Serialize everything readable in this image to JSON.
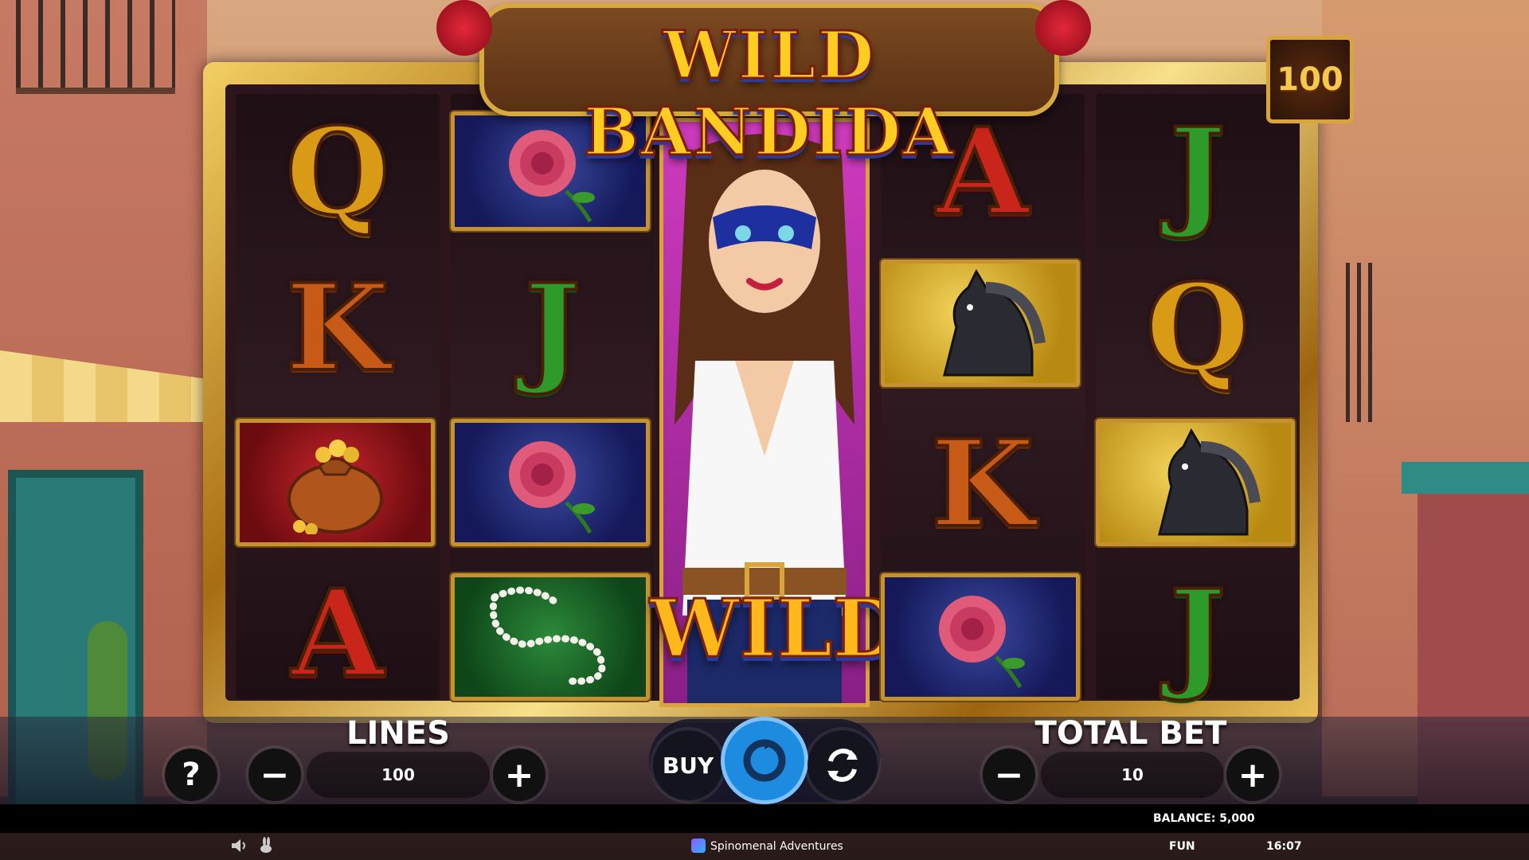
{
  "game": {
    "title": "WILD BANDIDA",
    "lines_badge": "100",
    "wild_label": "WILD"
  },
  "reels": [
    [
      "Q",
      "K",
      "money-bag",
      "A"
    ],
    [
      "rose",
      "J",
      "rose",
      "pearls"
    ],
    [
      "wild-bandida"
    ],
    [
      "A",
      "horse",
      "K",
      "rose"
    ],
    [
      "J",
      "Q",
      "horse",
      "J"
    ]
  ],
  "controls": {
    "help_label": "?",
    "lines_label": "LINES",
    "lines_value": "100",
    "lines_minus": "−",
    "lines_plus": "+",
    "buy_label": "BUY",
    "total_bet_label": "TOTAL BET",
    "total_bet_value": "10",
    "bet_minus": "−",
    "bet_plus": "+",
    "spin_icon": "spin-icon",
    "autoplay_icon": "autoplay-icon"
  },
  "footer": {
    "balance": "BALANCE: 5,000",
    "mode": "FUN",
    "time": "16:07",
    "brand": "Spinomenal Adventures",
    "sound_icon": "speaker-icon",
    "turbo_icon": "rabbit-icon"
  },
  "colors": {
    "frame_gold": "#d9a43a",
    "title_yellow": "#ffcc22",
    "spin_blue": "#1d8be0",
    "reel_bg": "#2c161b"
  }
}
